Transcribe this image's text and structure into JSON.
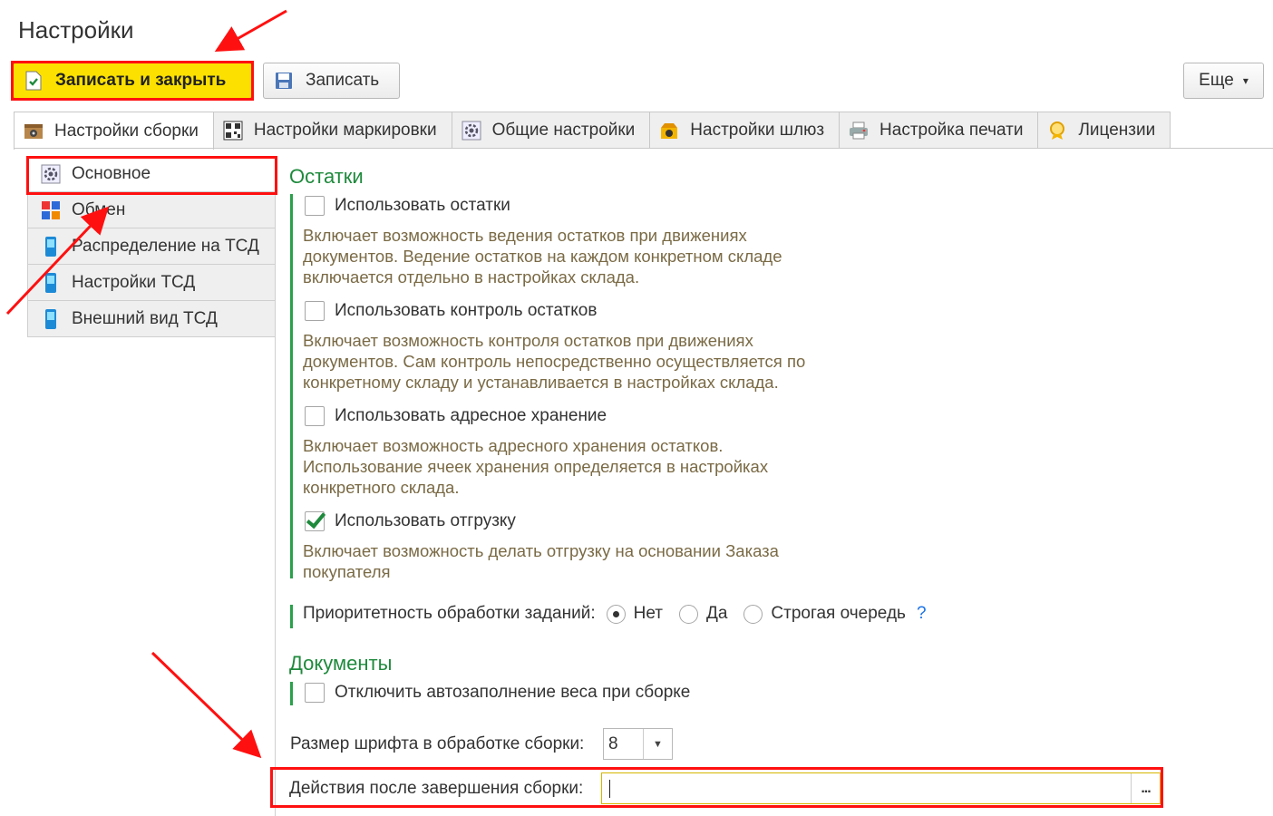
{
  "window": {
    "title": "Настройки"
  },
  "toolbar": {
    "save_close_label": "Записать и закрыть",
    "save_label": "Записать",
    "more_label": "Еще",
    "more_arrow": "▾"
  },
  "tabs": [
    {
      "label": "Настройки сборки",
      "icon": "box-gear-icon",
      "active": true
    },
    {
      "label": "Настройки маркировки",
      "icon": "qr-code-icon"
    },
    {
      "label": "Общие настройки",
      "icon": "gear-icon"
    },
    {
      "label": "Настройки шлюз",
      "icon": "gateway-icon"
    },
    {
      "label": "Настройка печати",
      "icon": "printer-icon"
    },
    {
      "label": "Лицензии",
      "icon": "license-icon"
    }
  ],
  "sidebar": {
    "items": [
      {
        "label": "Основное",
        "icon": "gear-icon",
        "selected": true
      },
      {
        "label": "Обмен",
        "icon": "exchange-icon"
      },
      {
        "label": "Распределение на ТСД",
        "icon": "handheld-icon"
      },
      {
        "label": "Настройки ТСД",
        "icon": "handheld-icon"
      },
      {
        "label": "Внешний вид ТСД",
        "icon": "handheld-icon"
      }
    ]
  },
  "remains": {
    "heading": "Остатки",
    "options": [
      {
        "label": "Использовать остатки",
        "checked": false,
        "desc": [
          "Включает возможность ведения остатков при движениях",
          "документов. Ведение остатков на каждом конкретном складе",
          "включается отдельно в настройках склада."
        ]
      },
      {
        "label": "Использовать контроль остатков",
        "checked": false,
        "desc": [
          "Включает возможность контроля остатков при движениях",
          "документов. Сам контроль непосредственно осуществляется по",
          "конкретному складу и устанавливается в настройках склада."
        ]
      },
      {
        "label": "Использовать адресное хранение",
        "checked": false,
        "desc": [
          "Включает возможность адресного хранения остатков.",
          "Использование ячеек хранения определяется в настройках",
          "конкретного склада."
        ]
      },
      {
        "label": "Использовать отгрузку",
        "checked": true,
        "desc": [
          "Включает возможность делать отгрузку на основании Заказа",
          "покупателя"
        ]
      }
    ]
  },
  "priority": {
    "label": "Приоритетность обработки заданий:",
    "options": [
      "Нет",
      "Да",
      "Строгая очередь"
    ],
    "selected": "Нет",
    "help": "?"
  },
  "documents": {
    "heading": "Документы",
    "autofill_label": "Отключить автозаполнение веса при сборке",
    "autofill_checked": false
  },
  "font_size": {
    "label": "Размер шрифта в обработке сборки:",
    "value": "8"
  },
  "after_actions": {
    "label": "Действия после завершения сборки:",
    "value": "",
    "button": "..."
  },
  "colors": {
    "accent": "#fce100",
    "heading_green": "#1e8a3c",
    "desc_brown": "#7a6a45",
    "highlight": "#ff1010"
  }
}
